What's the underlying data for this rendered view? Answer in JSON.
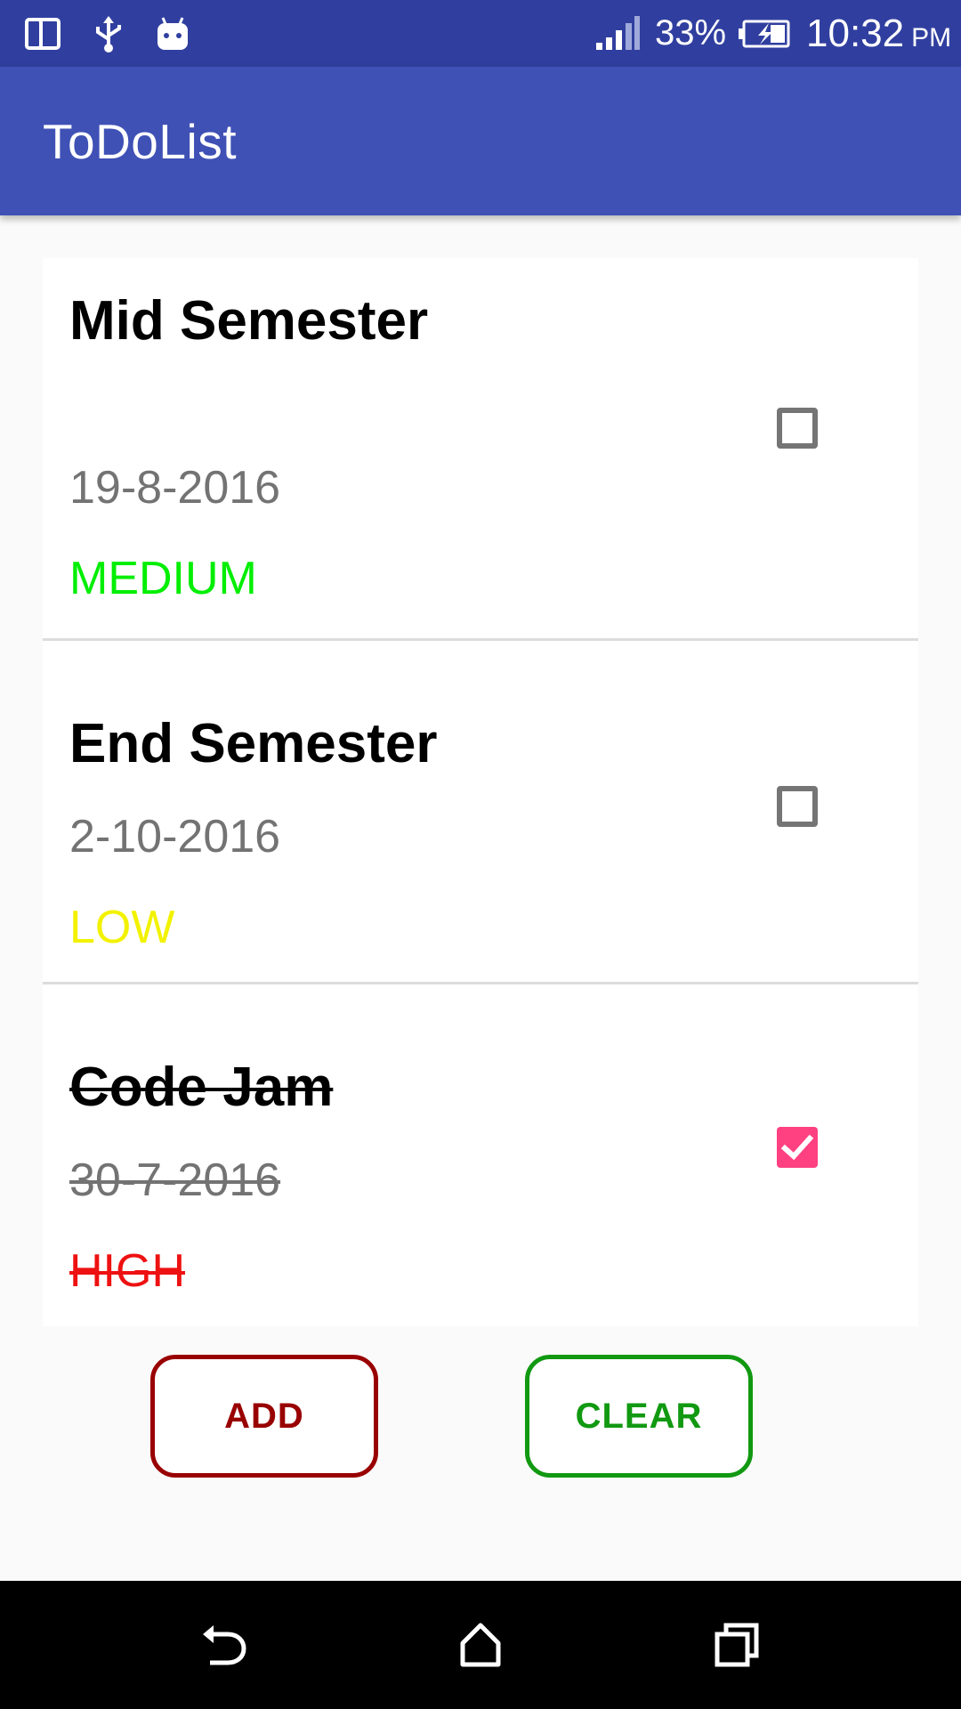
{
  "status_bar": {
    "battery_percent": "33%",
    "time": "10:32",
    "time_suffix": "PM",
    "icons": [
      "device-icon",
      "usb-icon",
      "android-debug-icon",
      "signal-icon",
      "battery-charging-icon"
    ]
  },
  "app_bar": {
    "title": "ToDoList",
    "color": "#3f51b5",
    "status_color": "#303f9f"
  },
  "todos": [
    {
      "title": "Mid Semester",
      "date": "19-8-2016",
      "priority": "MEDIUM",
      "priority_color": "#00ee00",
      "checked": false
    },
    {
      "title": "End Semester",
      "date": "2-10-2016",
      "priority": "LOW",
      "priority_color": "#f2f200",
      "checked": false
    },
    {
      "title": "Code Jam",
      "date": "30-7-2016",
      "priority": "HIGH",
      "priority_color": "#ee1111",
      "checked": true
    }
  ],
  "actions": {
    "add_label": "ADD",
    "add_color": "#990000",
    "clear_label": "CLEAR",
    "clear_color": "#119911"
  },
  "accent_color": "#ff4081",
  "nav_bar": {
    "icons": [
      "back-icon",
      "home-icon",
      "recents-icon"
    ]
  }
}
